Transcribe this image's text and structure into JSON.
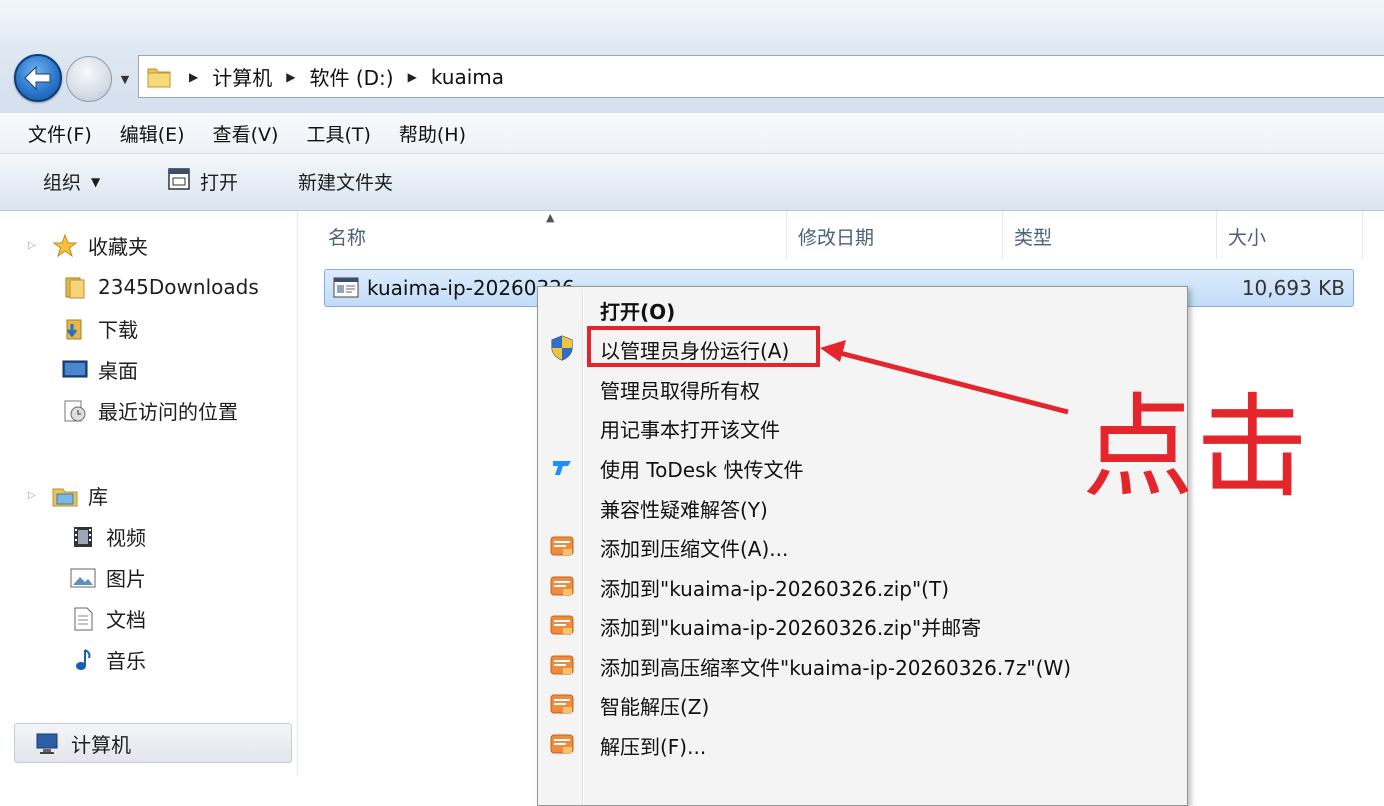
{
  "address": {
    "path": [
      "计算机",
      "软件 (D:)",
      "kuaima"
    ]
  },
  "menubar": {
    "items": [
      "文件(F)",
      "编辑(E)",
      "查看(V)",
      "工具(T)",
      "帮助(H)"
    ]
  },
  "commandbar": {
    "organize": "组织",
    "open": "打开",
    "new_folder": "新建文件夹"
  },
  "navpane": {
    "favorites": {
      "label": "收藏夹",
      "items": [
        "2345Downloads",
        "下载",
        "桌面",
        "最近访问的位置"
      ]
    },
    "libraries": {
      "label": "库",
      "items": [
        "视频",
        "图片",
        "文档",
        "音乐"
      ]
    },
    "computer": "计算机"
  },
  "filelist": {
    "columns": [
      "名称",
      "修改日期",
      "类型",
      "大小"
    ],
    "file": {
      "name": "kuaima-ip-20260326",
      "size": "10,693 KB"
    }
  },
  "context_menu": {
    "items": [
      {
        "label": "打开(O)",
        "icon": "none",
        "bold": true
      },
      {
        "label": "以管理员身份运行(A)",
        "icon": "uac-shield-icon"
      },
      {
        "label": "管理员取得所有权",
        "icon": "none"
      },
      {
        "label": "用记事本打开该文件",
        "icon": "none"
      },
      {
        "label": "使用 ToDesk 快传文件",
        "icon": "todesk-icon"
      },
      {
        "label": "兼容性疑难解答(Y)",
        "icon": "none"
      },
      {
        "label": "添加到压缩文件(A)...",
        "icon": "archive-icon"
      },
      {
        "label": "添加到\"kuaima-ip-20260326.zip\"(T)",
        "icon": "archive-icon"
      },
      {
        "label": "添加到\"kuaima-ip-20260326.zip\"并邮寄",
        "icon": "archive-icon"
      },
      {
        "label": "添加到高压缩率文件\"kuaima-ip-20260326.7z\"(W)",
        "icon": "archive-icon"
      },
      {
        "label": "智能解压(Z)",
        "icon": "archive-icon"
      },
      {
        "label": "解压到(F)...",
        "icon": "archive-icon"
      }
    ]
  },
  "annotation": {
    "text": "点击",
    "color": "#e3262c"
  }
}
